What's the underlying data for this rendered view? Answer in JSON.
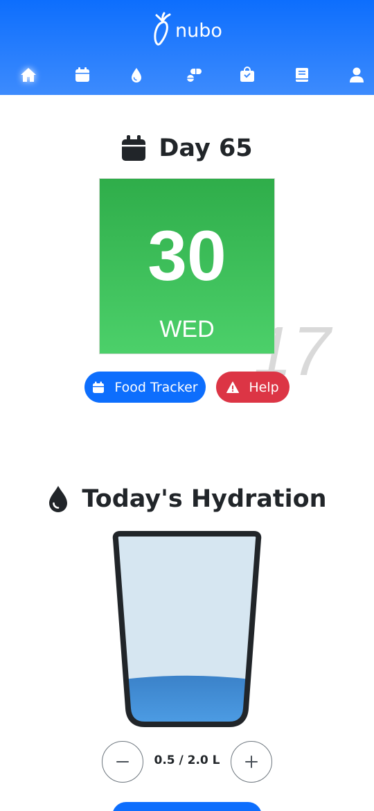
{
  "app": {
    "brand": "nubo",
    "logo_icon": "carrot-outline-logo",
    "accent_color": "#0d6efd",
    "nav": [
      {
        "icon": "home-icon",
        "active": true
      },
      {
        "icon": "calendar-icon",
        "active": false
      },
      {
        "icon": "water-drop-icon",
        "active": false
      },
      {
        "icon": "pills-icon",
        "active": false
      },
      {
        "icon": "shopping-bag-icon",
        "active": false
      },
      {
        "icon": "book-icon",
        "active": false
      },
      {
        "icon": "user-icon",
        "active": false
      }
    ]
  },
  "day": {
    "title": "Day 65",
    "date_number": "30",
    "weekday": "WED",
    "watermark": "17",
    "tile_color": "#2fad4a"
  },
  "actions": {
    "food_tracker": "Food Tracker",
    "help": "Help",
    "food_color": "#0d6efd",
    "help_color": "#dc3545"
  },
  "hydration": {
    "title": "Today's Hydration",
    "value_label": "0.5 / 2.0 L",
    "current_liters": 0.5,
    "goal_liters": 2.0,
    "fill_fraction": 0.25
  }
}
